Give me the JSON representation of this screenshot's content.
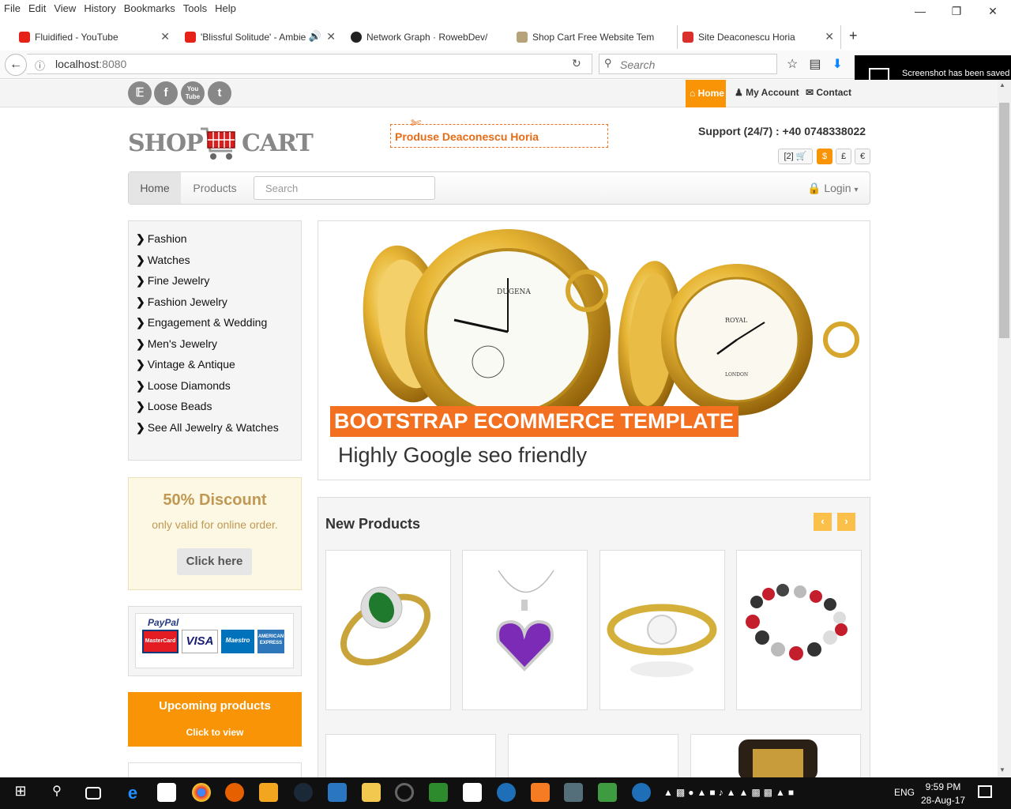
{
  "browser": {
    "menu": [
      "File",
      "Edit",
      "View",
      "History",
      "Bookmarks",
      "Tools",
      "Help"
    ],
    "tabs": [
      {
        "title": "Fluidified - YouTube",
        "color": "#e62117"
      },
      {
        "title": "'Blissful Solitude' - Ambie",
        "color": "#e62117"
      },
      {
        "title": "Network Graph · RowebDev/",
        "color": "#222222"
      },
      {
        "title": "Shop Cart Free Website Tem",
        "color": "#b6a37b"
      },
      {
        "title": "Site Deaconescu Horia",
        "color": "#d9302c"
      }
    ],
    "url_host": "localhost",
    "url_port": ":8080",
    "search_placeholder": "Search",
    "toast": "Screenshot has been saved to Gallery"
  },
  "site": {
    "social": [
      "twitter-icon",
      "facebook-icon",
      "youtube-icon",
      "tumblr-icon"
    ],
    "social_glyphs": [
      "t",
      "f",
      "You Tube",
      "t"
    ],
    "top_links": {
      "home": "Home",
      "account": "My Account",
      "contact": "Contact"
    },
    "logo": {
      "left": "SHOP",
      "right": "CART"
    },
    "coupon_text": "Produse Deaconescu Horia",
    "support": "Support (24/7) : +40 0748338022",
    "cart_count": "[2]",
    "currencies": [
      "$",
      "£",
      "€"
    ],
    "nav": {
      "home": "Home",
      "products": "Products",
      "search_placeholder": "Search",
      "login": "Login"
    },
    "categories": [
      "Fashion",
      "Watches",
      "Fine Jewelry",
      "Fashion Jewelry",
      "Engagement & Wedding",
      "Men's Jewelry",
      "Vintage & Antique",
      "Loose Diamonds",
      "Loose Beads",
      "See All Jewelry & Watches"
    ],
    "discount": {
      "title": "50% Discount",
      "subtitle": "only valid for online order.",
      "button": "Click here"
    },
    "payment": {
      "brand": "PayPal",
      "cards": [
        "MasterCard",
        "VISA",
        "Maestro",
        "AMERICAN EXPRESS"
      ]
    },
    "upcoming": {
      "title": "Upcoming products",
      "subtitle": "Click to view"
    },
    "hero": {
      "title": "BOOTSTRAP ECOMMERCE TEMPLATE",
      "subtitle": "Highly Google seo friendly",
      "watch_left_brand": "DUGENA",
      "watch_right_brand": "ROYAL",
      "watch_right_city": "LONDON"
    },
    "new_products": {
      "title": "New Products",
      "prev": "‹",
      "next": "›",
      "items": [
        "emerald-ring",
        "amethyst-heart-pendant",
        "diamond-gold-ring",
        "bead-bracelet"
      ]
    }
  },
  "taskbar": {
    "lang": "ENG",
    "time": "9:59 PM",
    "date": "28-Aug-17"
  }
}
